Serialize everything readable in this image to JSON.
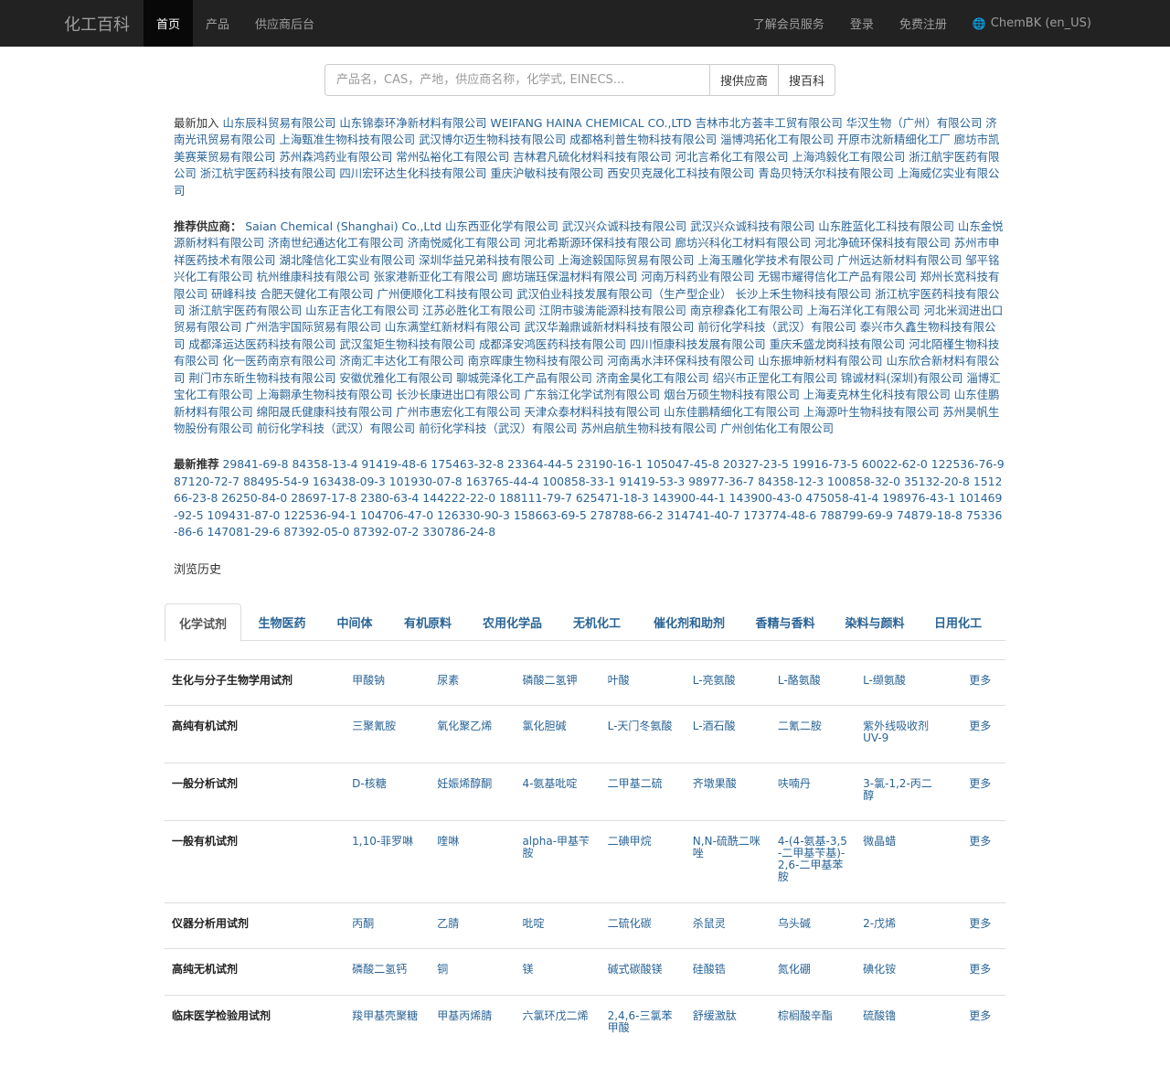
{
  "navbar": {
    "brand": "化工百科",
    "items": [
      "首页",
      "产品",
      "供应商后台"
    ],
    "right_items": [
      "了解会员服务",
      "登录",
      "免费注册",
      "ChemBK (en_US)"
    ]
  },
  "search": {
    "placeholder": "产品名，CAS，产地，供应商名称，化学式, EINECS...",
    "buttons": [
      "搜供应商",
      "搜百科"
    ]
  },
  "latest": {
    "label": "最新加入",
    "text": "山东辰科贸易有限公司 山东锦泰环净新材料有限公司 WEIFANG HAINA CHEMICAL CO.,LTD 吉林市北方荟丰工贸有限公司 华汉生物（广州）有限公司 济南光讯贸易有限公司 上海甄准生物科技有限公司 武汉博尔迈生物科技有限公司 成都格利普生物科技有限公司 淄博鸿拓化工有限公司 开原市沈新精细化工厂 廊坊市凯美赛莱贸易有限公司 苏州森鸿药业有限公司 常州弘裕化工有限公司 吉林君凡硫化材料科技有限公司 河北言希化工有限公司 上海鸿毅化工有限公司 浙江航宇医药有限公司 浙江杭宇医药科技有限公司 四川宏环达生化科技有限公司 重庆沪敏科技有限公司 西安贝克晟化工科技有限公司 青岛贝特沃尔科技有限公司 上海威亿实业有限公司"
  },
  "recommended": {
    "label": "推荐供应商：",
    "text": "Saian Chemical (Shanghai) Co.,Ltd 山东西亚化学有限公司 武汉兴众诚科技有限公司 武汉兴众诚科技有限公司 山东胜蓝化工科技有限公司 山东金悦源新材料有限公司 济南世纪通达化工有限公司 济南悦威化工有限公司 河北希斯源环保科技有限公司 廊坊兴科化工材料有限公司 河北净硫环保科技有限公司 苏州市申祥医药技术有限公司 湖北隆信化工实业有限公司 深圳华益兄弟科技有限公司 上海途毅国际贸易有限公司 上海玉雕化学技术有限公司 广州远达新材料有限公司 邹平铭兴化工有限公司 杭州维康科技有限公司 张家港新亚化工有限公司 廊坊瑞珏保温材料有限公司 河南万科药业有限公司 无锡市耀得信化工产品有限公司 郑州长宽科技有限公司 研峰科技 合肥天健化工有限公司 广州便顺化工科技有限公司 武汉伯业科技发展有限公司（生产型企业） 长沙上禾生物科技有限公司 浙江杭宇医药科技有限公司 浙江航宇医药有限公司 山东正吉化工有限公司 江苏必胜化工有限公司 江阴市骏涛能源科技有限公司 南京穆森化工有限公司 上海石洋化工有限公司 河北米润进出口贸易有限公司 广州浩宇国际贸易有限公司 山东满堂红新材料有限公司 武汉华瀚鼎诚新材料科技有限公司 前衍化学科技（武汉）有限公司 泰兴市久鑫生物科技有限公司 成都泽运达医药科技有限公司 武汉玺矩生物科技有限公司 成都泽安鸿医药科技有限公司 四川恒康科技发展有限公司 重庆禾盛龙岗科技有限公司 河北陌槿生物科技有限公司 化一医药南京有限公司 济南汇丰达化工有限公司 南京晖康生物科技有限公司 河南禹水沣环保科技有限公司 山东振坤新材料有限公司 山东欣合新材料有限公司 荆门市东昕生物科技有限公司 安徽优雅化工有限公司 聊城莞泽化工产品有限公司 济南金昊化工有限公司 绍兴市正罡化工有限公司 锦诚材料(深圳)有限公司 淄博汇宝化工有限公司 上海翾承生物科技有限公司 长沙长康进出口有限公司 广东翁江化学试剂有限公司 烟台万硕生物科技有限公司 上海麦克林生化科技有限公司 山东佳鹏新材料有限公司 绵阳晟氏健康科技有限公司 广州市惠宏化工有限公司 天津众泰材料科技有限公司 山东佳鹏精细化工有限公司 上海源叶生物科技有限公司 苏州昊帆生物股份有限公司 前衍化学科技（武汉）有限公司 前衍化学科技（武汉）有限公司 苏州启航生物科技有限公司 广州创佑化工有限公司"
  },
  "newest": {
    "label": "最新推荐",
    "text": "29841-69-8 84358-13-4 91419-48-6 175463-32-8 23364-44-5 23190-16-1 105047-45-8 20327-23-5 19916-73-5 60022-62-0 122536-76-9 87120-72-7 88495-54-9 163438-09-3 101930-07-8 163765-44-4 100858-33-1 91419-53-3 98977-36-7 84358-12-3 100858-32-0 35132-20-8 151266-23-8 26250-84-0 28697-17-8 2380-63-4 144222-22-0 188111-79-7 625471-18-3 143900-44-1 143900-43-0 475058-41-4 198976-43-1 101469-92-5 109431-87-0 122536-94-1 104706-47-0 126330-90-3 158663-69-5 278788-66-2 314741-40-7 173774-48-6 788799-69-9 74879-18-8 75336-86-6 147081-29-6 87392-05-0 87392-07-2 330786-24-8"
  },
  "history_label": "浏览历史",
  "tabs": [
    "化学试剂",
    "生物医药",
    "中间体",
    "有机原料",
    "农用化学品",
    "无机化工",
    "催化剂和助剂",
    "香精与香料",
    "染料与颜料",
    "日用化工"
  ],
  "categories": [
    {
      "name": "生化与分子生物学用试剂",
      "items": [
        "甲酸钠",
        "尿素",
        "磷酸二氢钾",
        "叶酸",
        "L-亮氨酸",
        "L-酪氨酸",
        "L-缬氨酸"
      ],
      "more": "更多"
    },
    {
      "name": "高纯有机试剂",
      "items": [
        "三聚氰胺",
        "氧化聚乙烯",
        "氯化胆碱",
        "L-天门冬氨酸",
        "L-酒石酸",
        "二氰二胺",
        "紫外线吸收剂UV-9"
      ],
      "more": "更多"
    },
    {
      "name": "一般分析试剂",
      "items": [
        "D-核糖",
        "妊娠烯醇酮",
        "4-氨基吡啶",
        "二甲基二硫",
        "齐墩果酸",
        "呋喃丹",
        "3-氯-1,2-丙二醇"
      ],
      "more": "更多"
    },
    {
      "name": "一般有机试剂",
      "items": [
        "1,10-菲罗啉",
        "喹啉",
        "alpha-甲基苄胺",
        "二碘甲烷",
        "N,N-硫酰二咪唑",
        "4-(4-氨基-3,5-二甲基苄基)-2,6-二甲基苯胺",
        "微晶蜡"
      ],
      "more": "更多"
    },
    {
      "name": "仪器分析用试剂",
      "items": [
        "丙酮",
        "乙腈",
        "吡啶",
        "二硫化碳",
        "杀鼠灵",
        "乌头碱",
        "2-戊烯"
      ],
      "more": "更多"
    },
    {
      "name": "高纯无机试剂",
      "items": [
        "磷酸二氢钙",
        "铜",
        "镁",
        "碱式碳酸镁",
        "硅酸锆",
        "氮化硼",
        "碘化铵"
      ],
      "more": "更多"
    },
    {
      "name": "临床医学检验用试剂",
      "items": [
        "羧甲基壳聚糖",
        "甲基丙烯腈",
        "六氯环戊二烯",
        "2,4,6-三氯苯甲酸",
        "舒缓激肽",
        "棕榈酸辛酯",
        "硫酸镥"
      ],
      "more": "更多"
    }
  ]
}
